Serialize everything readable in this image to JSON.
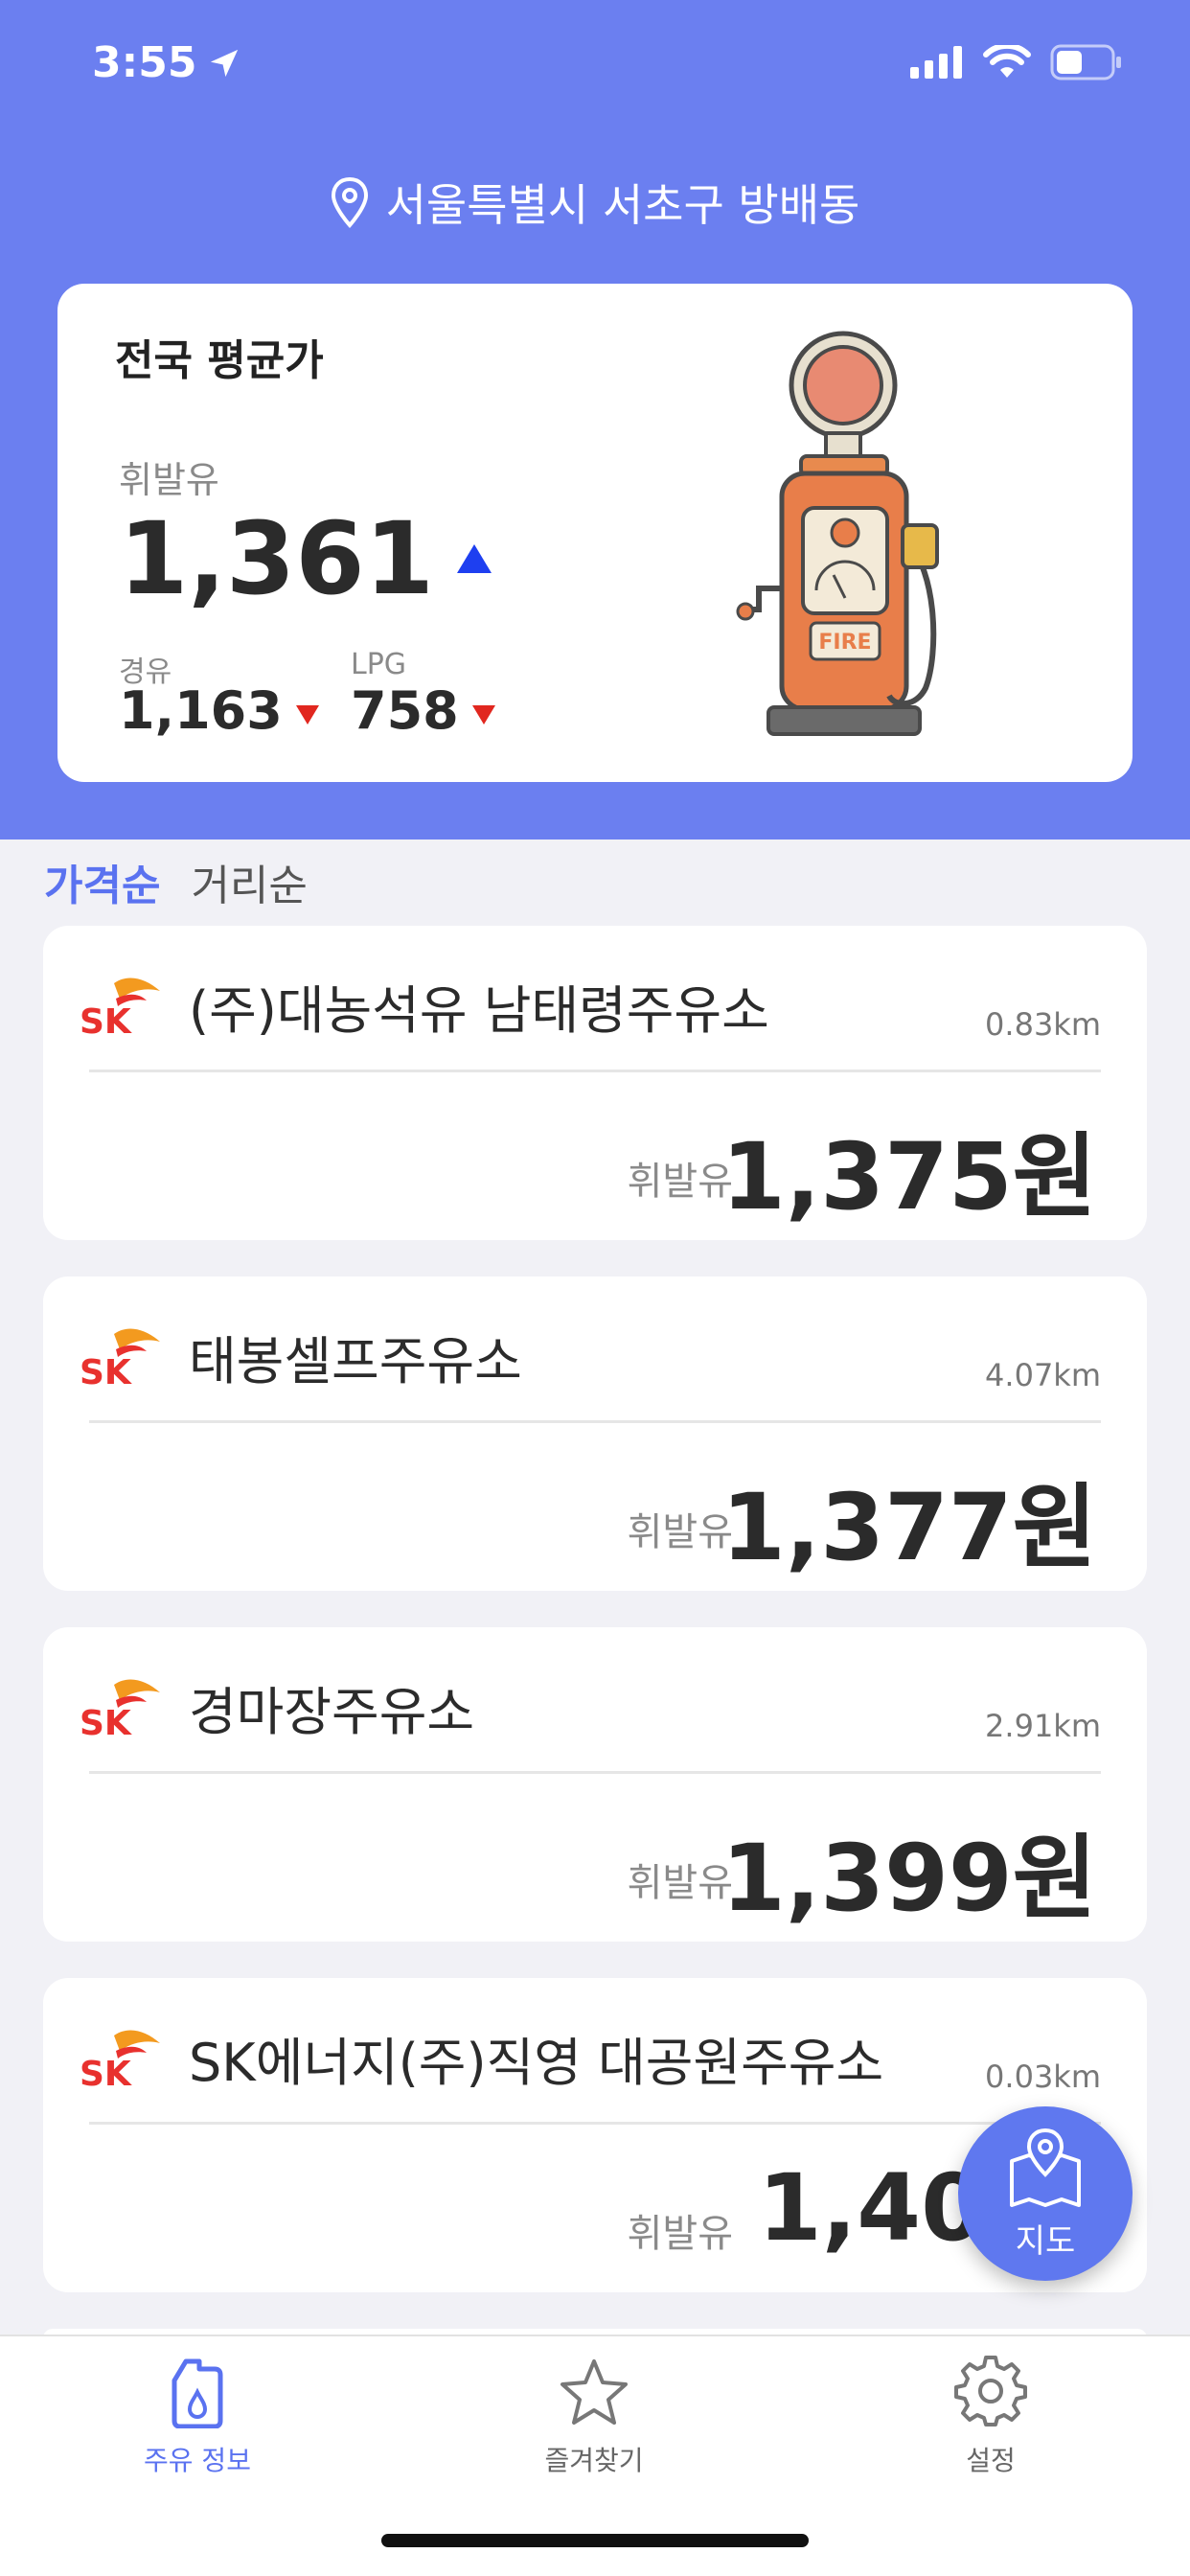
{
  "status_bar": {
    "time": "3:55"
  },
  "header": {
    "location": "서울특별시 서초구 방배동"
  },
  "average": {
    "title": "전국 평균가",
    "gasoline_label": "휘발유",
    "gasoline_price": "1,361",
    "diesel_label": "경유",
    "diesel_price": "1,163",
    "lpg_label": "LPG",
    "lpg_price": "758",
    "pump_text": "FIRE",
    "colors": {
      "up": "#1e3ff0",
      "down": "#e1271f"
    }
  },
  "sort": {
    "price": "가격순",
    "distance": "거리순"
  },
  "stations": [
    {
      "brand": "SK",
      "name": "(주)대농석유 남태령주유소",
      "distance": "0.83km",
      "fuel": "휘발유",
      "price": "1,375원"
    },
    {
      "brand": "SK",
      "name": "태봉셀프주유소",
      "distance": "4.07km",
      "fuel": "휘발유",
      "price": "1,377원"
    },
    {
      "brand": "SK",
      "name": "경마장주유소",
      "distance": "2.91km",
      "fuel": "휘발유",
      "price": "1,399원"
    },
    {
      "brand": "SK",
      "name": "SK에너지(주)직영 대공원주유소",
      "distance": "0.03km",
      "fuel": "휘발유",
      "price": "1,40"
    }
  ],
  "fab": {
    "label": "지도"
  },
  "tabbar": {
    "items": [
      {
        "label": "주유 정보"
      },
      {
        "label": "즐겨찾기"
      },
      {
        "label": "설정"
      }
    ]
  },
  "theme": {
    "primary": "#6b7ff0",
    "accent": "#5a72f0"
  }
}
